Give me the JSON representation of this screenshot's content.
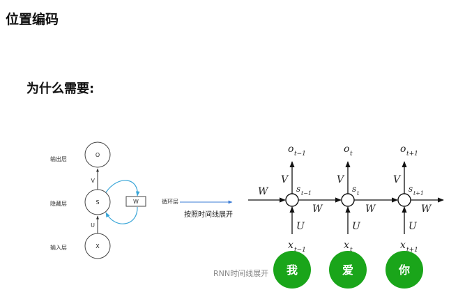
{
  "title": "位置编码",
  "subtitle": "为什么需要:",
  "left_diagram": {
    "layer_output": "输出层",
    "layer_hidden": "隐藏层",
    "layer_input": "输入层",
    "node_o": "O",
    "node_s": "S",
    "node_x": "X",
    "weight_v": "V",
    "weight_u": "U",
    "weight_w": "W",
    "recurrent_label": "循环层"
  },
  "arrow_label": "按照时间线展开",
  "right_diagram": {
    "w_in": "W",
    "w_between_1": "W",
    "w_between_2": "W",
    "w_out": "W",
    "steps": [
      {
        "o": "o",
        "o_sub": "t−1",
        "s": "s",
        "s_sub": "t−1",
        "x": "x",
        "x_sub": "t−1",
        "v": "V",
        "u": "U"
      },
      {
        "o": "o",
        "o_sub": "t",
        "s": "s",
        "s_sub": "t",
        "x": "x",
        "x_sub": "t",
        "v": "V",
        "u": "U"
      },
      {
        "o": "o",
        "o_sub": "t+1",
        "s": "s",
        "s_sub": "t+1",
        "x": "x",
        "x_sub": "t+1",
        "v": "V",
        "u": "U"
      }
    ]
  },
  "caption": "RNN时间线展开",
  "words": [
    "我",
    "爱",
    "你"
  ],
  "colors": {
    "word_circle": "#1aa51a",
    "loop_arrow": "#3aa6d8",
    "timeline_arrow": "#3a7bd5"
  }
}
